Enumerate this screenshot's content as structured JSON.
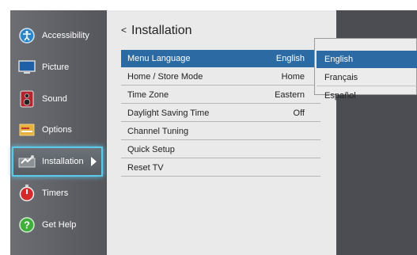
{
  "sidebar": {
    "items": [
      {
        "label": "Accessibility",
        "icon": "accessibility-icon"
      },
      {
        "label": "Picture",
        "icon": "picture-icon"
      },
      {
        "label": "Sound",
        "icon": "sound-icon"
      },
      {
        "label": "Options",
        "icon": "options-icon"
      },
      {
        "label": "Installation",
        "icon": "installation-icon"
      },
      {
        "label": "Timers",
        "icon": "timers-icon"
      },
      {
        "label": "Get Help",
        "icon": "help-icon"
      }
    ],
    "active_index": 4
  },
  "panel": {
    "back_glyph": "<",
    "title": "Installation",
    "rows": [
      {
        "label": "Menu Language",
        "value": "English"
      },
      {
        "label": "Home / Store Mode",
        "value": "Home"
      },
      {
        "label": "Time Zone",
        "value": "Eastern"
      },
      {
        "label": "Daylight Saving Time",
        "value": "Off"
      },
      {
        "label": "Channel Tuning",
        "value": ""
      },
      {
        "label": "Quick Setup",
        "value": ""
      },
      {
        "label": "Reset TV",
        "value": ""
      }
    ]
  },
  "dropdown": {
    "options": [
      "English",
      "Français",
      "Español"
    ],
    "selected": "English"
  },
  "colors": {
    "highlight": "#2c6aa3",
    "focus_glow": "#5ec8e8"
  }
}
